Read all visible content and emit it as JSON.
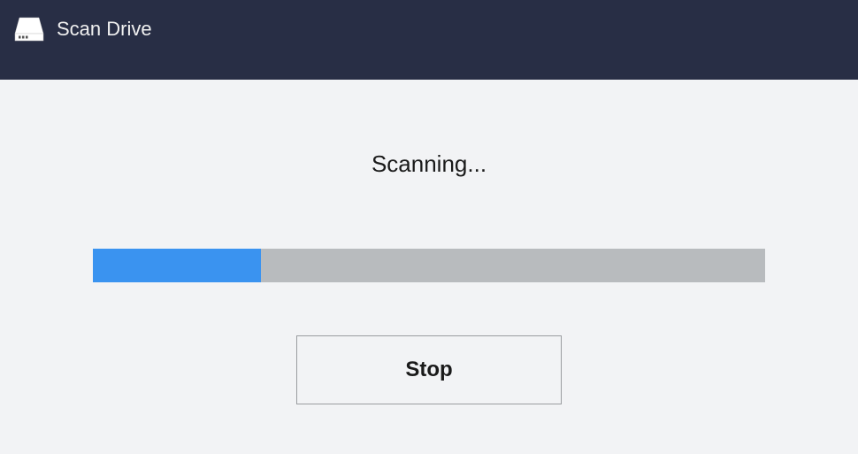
{
  "header": {
    "title": "Scan Drive"
  },
  "main": {
    "status_text": "Scanning...",
    "progress_percent": 25,
    "stop_button_label": "Stop"
  },
  "colors": {
    "header_bg": "#282e45",
    "content_bg": "#f2f3f5",
    "progress_bg": "#b8bbbe",
    "progress_fill": "#3a93f0"
  }
}
